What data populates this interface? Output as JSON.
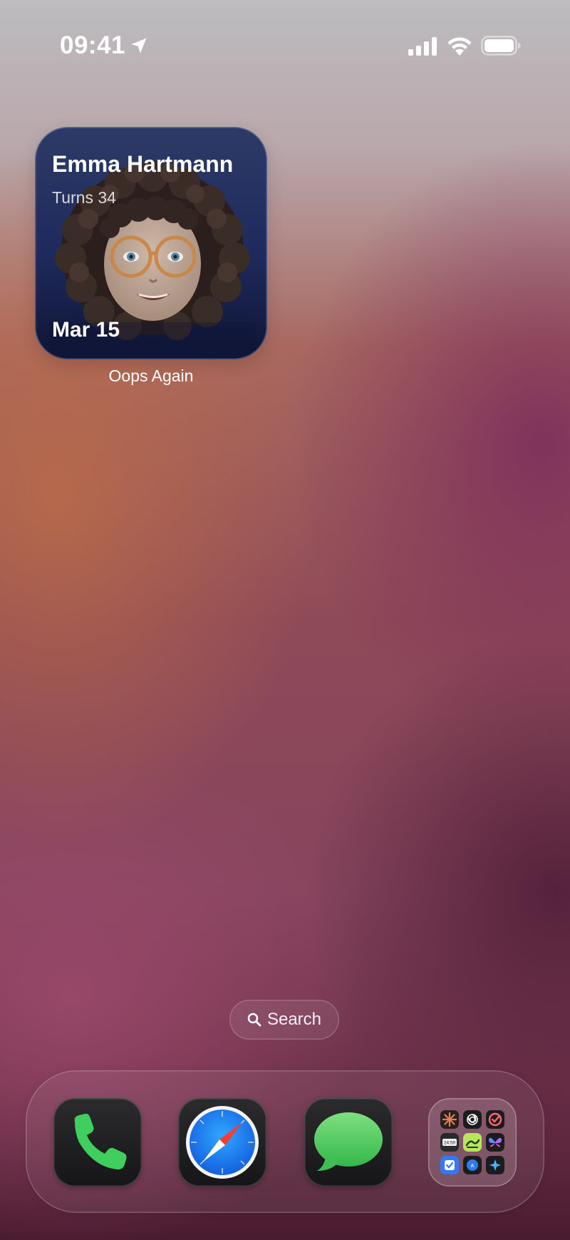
{
  "status_bar": {
    "time": "09:41",
    "icons": [
      "location-arrow-icon",
      "cellular-signal-icon",
      "wifi-icon",
      "battery-icon"
    ]
  },
  "widget": {
    "name": "Emma Hartmann",
    "subtitle": "Turns 34",
    "date": "Mar 15",
    "label": "Oops Again",
    "image": "memoji-avatar"
  },
  "search": {
    "label": "Search",
    "icon": "search-icon"
  },
  "dock": {
    "apps": [
      {
        "name": "Phone",
        "icon": "phone-icon",
        "color": "#34c759"
      },
      {
        "name": "Safari",
        "icon": "safari-compass-icon",
        "color": "#1a8cff"
      },
      {
        "name": "Messages",
        "icon": "messages-bubble-icon",
        "color": "#34c759"
      }
    ],
    "folder": {
      "icon": "app-folder",
      "mini_apps": [
        "claude-sunburst-icon",
        "chatgpt-knot-icon",
        "todo-check-icon",
        "clock-app-icon",
        "green-app-icon",
        "butterfly-icon",
        "check-box-icon",
        "translate-icon",
        "sparkle-icon"
      ],
      "clock_text": "24:59"
    }
  },
  "colors": {
    "widget_bg": "#1e2a5c",
    "wallpaper_top": "#bdbcbf",
    "wallpaper_bottom": "#4a1c30"
  }
}
